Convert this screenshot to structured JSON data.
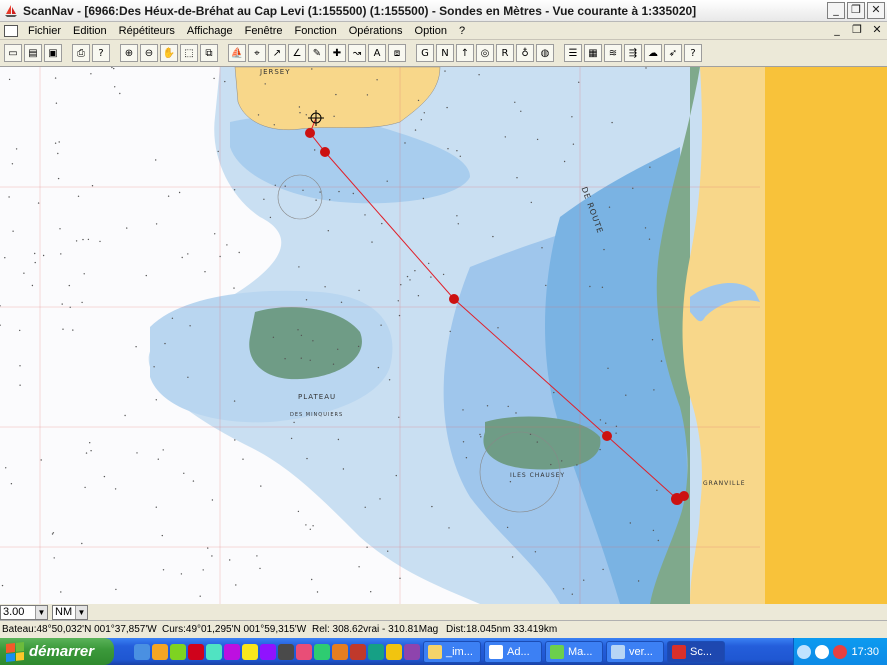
{
  "window": {
    "title": "ScanNav - [6966:Des Héux-de-Bréhat au Cap Levi (1:155500) (1:155500) - Sondes en  Mètres  - Vue courante à 1:335020]",
    "controls": [
      "_",
      "❐",
      "✕"
    ]
  },
  "menubar": {
    "items": [
      "Fichier",
      "Edition",
      "Répétiteurs",
      "Affichage",
      "Fenêtre",
      "Fonction",
      "Opérations",
      "Option",
      "?"
    ],
    "mdi_controls": [
      "_",
      "❐",
      "✕"
    ]
  },
  "toolbar": {
    "buttons": [
      {
        "icon": "new-icon",
        "glyph": "▭"
      },
      {
        "icon": "open-icon",
        "glyph": "▤"
      },
      {
        "icon": "save-icon",
        "glyph": "▣"
      },
      {
        "icon": "print-icon",
        "glyph": "⎙"
      },
      {
        "icon": "help-pointer-icon",
        "glyph": "?"
      },
      {
        "icon": "zoom-in-icon",
        "glyph": "⊕"
      },
      {
        "icon": "zoom-out-icon",
        "glyph": "⊖"
      },
      {
        "icon": "pan-hand-icon",
        "glyph": "✋"
      },
      {
        "icon": "select-rect-icon",
        "glyph": "⬚"
      },
      {
        "icon": "zoom-window-icon",
        "glyph": "⧉"
      },
      {
        "icon": "boat-icon",
        "glyph": "⛵"
      },
      {
        "icon": "target-icon",
        "glyph": "⌖"
      },
      {
        "icon": "route-icon",
        "glyph": "↗"
      },
      {
        "icon": "measure-icon",
        "glyph": "∠"
      },
      {
        "icon": "mark-icon",
        "glyph": "✎"
      },
      {
        "icon": "waypoint-icon",
        "glyph": "✚"
      },
      {
        "icon": "track-icon",
        "glyph": "↝"
      },
      {
        "icon": "text-icon",
        "glyph": "A"
      },
      {
        "icon": "layers-icon",
        "glyph": "⧈"
      },
      {
        "icon": "gps-icon",
        "glyph": "G"
      },
      {
        "icon": "nmea-icon",
        "glyph": "N"
      },
      {
        "icon": "up-arrow-icon",
        "glyph": "↑"
      },
      {
        "icon": "goto-icon",
        "glyph": "◎"
      },
      {
        "icon": "route-plan-icon",
        "glyph": "R"
      },
      {
        "icon": "mob-icon",
        "glyph": "♁"
      },
      {
        "icon": "lifebuoy-icon",
        "glyph": "◍"
      },
      {
        "icon": "chart-list-icon",
        "glyph": "☰"
      },
      {
        "icon": "chart-view-icon",
        "glyph": "▦"
      },
      {
        "icon": "tide-icon",
        "glyph": "≋"
      },
      {
        "icon": "current-icon",
        "glyph": "⇶"
      },
      {
        "icon": "weather-icon",
        "glyph": "☁"
      },
      {
        "icon": "wind-icon",
        "glyph": "➶"
      },
      {
        "icon": "info-icon",
        "glyph": "?"
      }
    ]
  },
  "chart": {
    "place_labels": [
      {
        "text": "JERSEY"
      },
      {
        "text": "GRANVILLE"
      },
      {
        "text": "PLATEAU"
      },
      {
        "text": "DES MINQUIERS"
      },
      {
        "text": "ILES CHAUSEY"
      },
      {
        "text": "DE ROUTE"
      }
    ]
  },
  "scale": {
    "value": "3.00",
    "unit": "NM"
  },
  "status": {
    "boat": "Bateau:48°50,032'N 001°37,857'W",
    "cursor": "Curs:49°01,295'N 001°59,315'W",
    "relative": "Rel: 308.62vrai - 310.81Mag",
    "distance": "Dist:18.045nm  33.419km"
  },
  "taskbar": {
    "start_label": "démarrer",
    "tasks": [
      {
        "label": "_im...",
        "color": "#f5d36a"
      },
      {
        "label": "Ad...",
        "color": "#ffffff"
      },
      {
        "label": "Ma...",
        "color": "#6ccf4c"
      },
      {
        "label": "ver...",
        "color": "#b7d5f5"
      },
      {
        "label": "Sc...",
        "color": "#d9302a"
      }
    ],
    "clock": "17:30"
  },
  "colors": {
    "land": "#f8d78a",
    "deep_water": "#ffffff",
    "shallow_water": "#c7def3",
    "drying": "#76aee0",
    "foreshore": "#7fa98c",
    "route": "#e0202a"
  }
}
